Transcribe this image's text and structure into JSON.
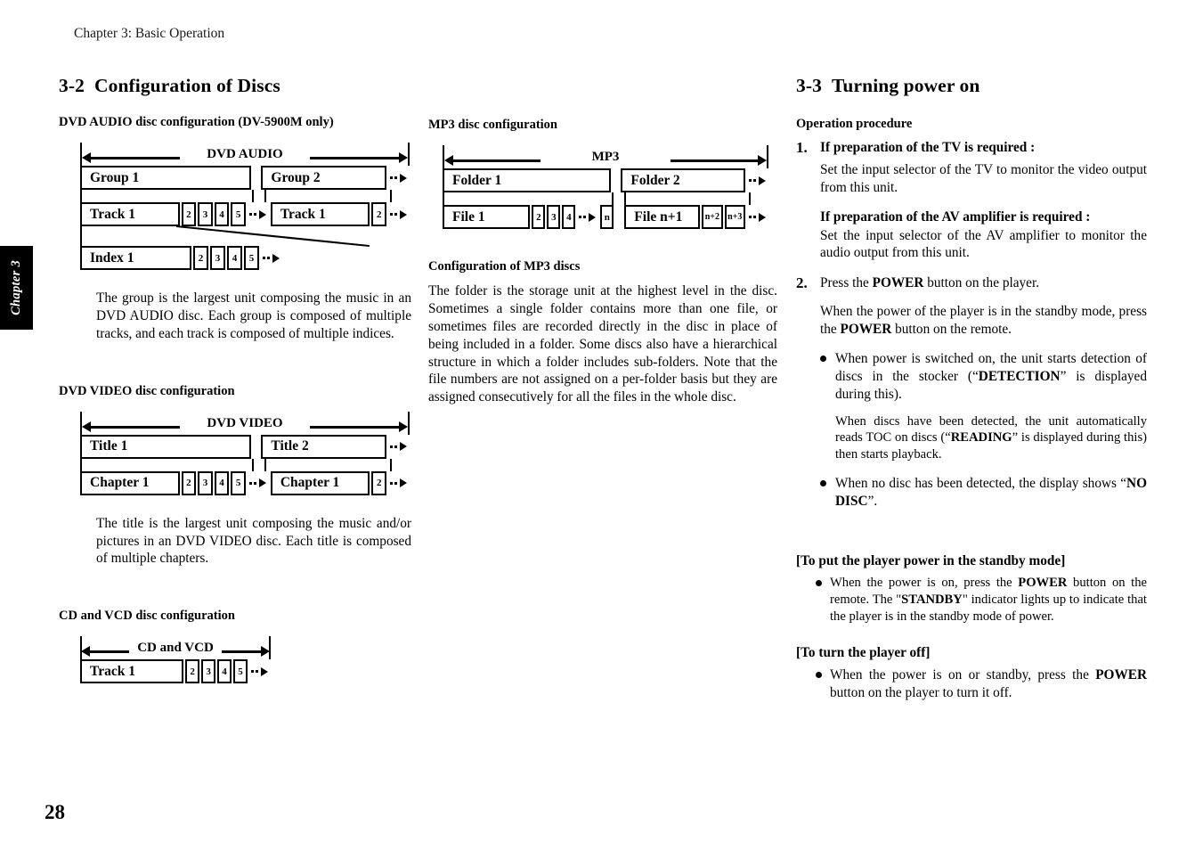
{
  "running_head": "Chapter 3: Basic Operation",
  "chapter_tab": "Chapter 3",
  "page_number": "28",
  "left_column": {
    "section": {
      "number": "3-2",
      "title": "Configuration of Discs"
    },
    "dvd_audio": {
      "heading": "DVD AUDIO disc configuration (DV-5900M only)",
      "span_label": "DVD AUDIO",
      "group1": "Group 1",
      "group2": "Group 2",
      "track1_a": "Track 1",
      "track1_b": "Track 1",
      "index1": "Index 1",
      "track_a_nums": [
        "2",
        "3",
        "4",
        "5"
      ],
      "track_b_nums": [
        "2"
      ],
      "index_nums": [
        "2",
        "3",
        "4",
        "5"
      ],
      "note": "The group is the largest unit composing the music in an DVD AUDIO disc. Each group is composed of multiple tracks, and each track is composed of multiple indices."
    },
    "dvd_video": {
      "heading": "DVD VIDEO disc configuration",
      "span_label": "DVD VIDEO",
      "title1": "Title 1",
      "title2": "Title 2",
      "chapter1_a": "Chapter 1",
      "chapter1_b": "Chapter 1",
      "chapter_a_nums": [
        "2",
        "3",
        "4",
        "5"
      ],
      "chapter_b_nums": [
        "2"
      ],
      "note": "The title is the largest unit composing the music and/or pictures in an DVD VIDEO disc. Each title is composed of multiple chapters."
    },
    "cd_vcd": {
      "heading": "CD and VCD disc configuration",
      "span_label": "CD and VCD",
      "track1": "Track 1",
      "track_nums": [
        "2",
        "3",
        "4",
        "5"
      ]
    }
  },
  "middle_column": {
    "mp3": {
      "heading": "MP3 disc configuration",
      "span_label": "MP3",
      "folder1": "Folder 1",
      "folder2": "Folder 2",
      "file1": "File 1",
      "file_n1": "File n+1",
      "file1_nums": [
        "2",
        "3",
        "4"
      ],
      "file1_last": "n",
      "file_n1_nums": [
        "n+2",
        "n+3"
      ]
    },
    "mp3_config": {
      "heading": "Configuration of MP3 discs",
      "body": "The folder is the storage unit at the highest level in the disc. Sometimes a single folder contains more than one file, or sometimes files are recorded directly in the disc in place of being included in a folder. Some discs also have a hierarchical structure in which a folder includes sub-folders. Note that the file numbers are not assigned on a per-folder basis but they are assigned consecutively for all the files in the whole disc."
    }
  },
  "right_column": {
    "section": {
      "number": "3-3",
      "title": "Turning power on"
    },
    "operation_heading": "Operation procedure",
    "step1": {
      "number": "1.",
      "heading": "If preparation of the TV is required :",
      "body": "Set the input selector of the TV to monitor the video output from this unit.",
      "sub_heading": "If preparation of the AV amplifier is required :",
      "sub_body": "Set the input selector of the AV amplifier to monitor the audio output from this unit."
    },
    "step2": {
      "number": "2.",
      "lead_a": "Press the ",
      "lead_power": "POWER",
      "lead_b": " button on the player.",
      "para_a": "When the power of the player is in the standby mode, press the ",
      "para_power": "POWER",
      "para_b": " button on the remote.",
      "bullet1_a": "When power is switched on, the unit starts detection of discs in the stocker (“",
      "bullet1_bold": "DETECTION",
      "bullet1_b": "” is displayed during this).",
      "sub_para_a": "When discs have been detected, the unit automatically reads TOC on discs (“",
      "sub_para_bold": "READING",
      "sub_para_b": "” is displayed during this) then starts playback.",
      "bullet2_a": "When no disc has been detected, the display shows “",
      "bullet2_bold": "NO DISC",
      "bullet2_b": "”."
    },
    "standby": {
      "heading": "[To put the player power in the standby mode]",
      "bullet_a": "When the power is on, press the ",
      "bullet_power": "POWER",
      "bullet_b": " button on the remote. The \"",
      "bullet_bold2": "STANDBY",
      "bullet_c": "\" indicator lights up to indicate that the player is in the standby mode of power."
    },
    "turn_off": {
      "heading": "[To turn the player off]",
      "bullet_a": "When the power is on or standby, press the ",
      "bullet_power": "POWER",
      "bullet_b": " button on the player to turn it off."
    }
  }
}
